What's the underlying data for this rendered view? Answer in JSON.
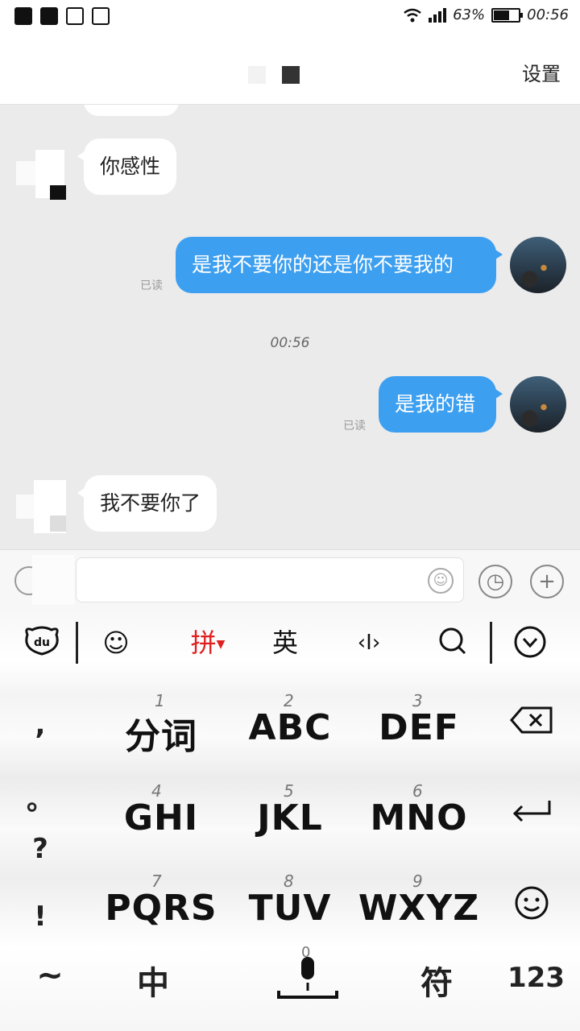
{
  "status_bar": {
    "icons_left": [
      "qq-icon",
      "app-icon",
      "keyboard-icon",
      "image-icon"
    ],
    "battery_percent": "63%",
    "battery_level": 0.63,
    "time": "00:56"
  },
  "header": {
    "settings_label": "设置"
  },
  "messages": [
    {
      "side": "in",
      "text": "你感性"
    },
    {
      "side": "out",
      "text": "是我不要你的还是你不要我的",
      "read_label": "已读"
    },
    {
      "side": "out",
      "text": "是我的错",
      "read_label": "已读"
    },
    {
      "side": "in",
      "text": "我不要你了"
    }
  ],
  "timestamp": "00:56",
  "keyboard": {
    "toolbar": {
      "pinyin_label": "拼",
      "english_label": "英",
      "cursor_label": "‹I›"
    },
    "keys": [
      {
        "num": "1",
        "label": "分词"
      },
      {
        "num": "2",
        "label": "ABC"
      },
      {
        "num": "3",
        "label": "DEF"
      },
      {
        "num": "4",
        "label": "GHI"
      },
      {
        "num": "5",
        "label": "JKL"
      },
      {
        "num": "6",
        "label": "MNO"
      },
      {
        "num": "7",
        "label": "PQRS"
      },
      {
        "num": "8",
        "label": "TUV"
      },
      {
        "num": "9",
        "label": "WXYZ"
      }
    ],
    "punctuation": [
      ",",
      "。",
      "?",
      "!"
    ],
    "bottom": {
      "tilde": "~",
      "chinese": "中",
      "space_num": "0",
      "symbols": "符",
      "numbers": "123"
    },
    "colors": {
      "accent": "#e02020"
    }
  }
}
